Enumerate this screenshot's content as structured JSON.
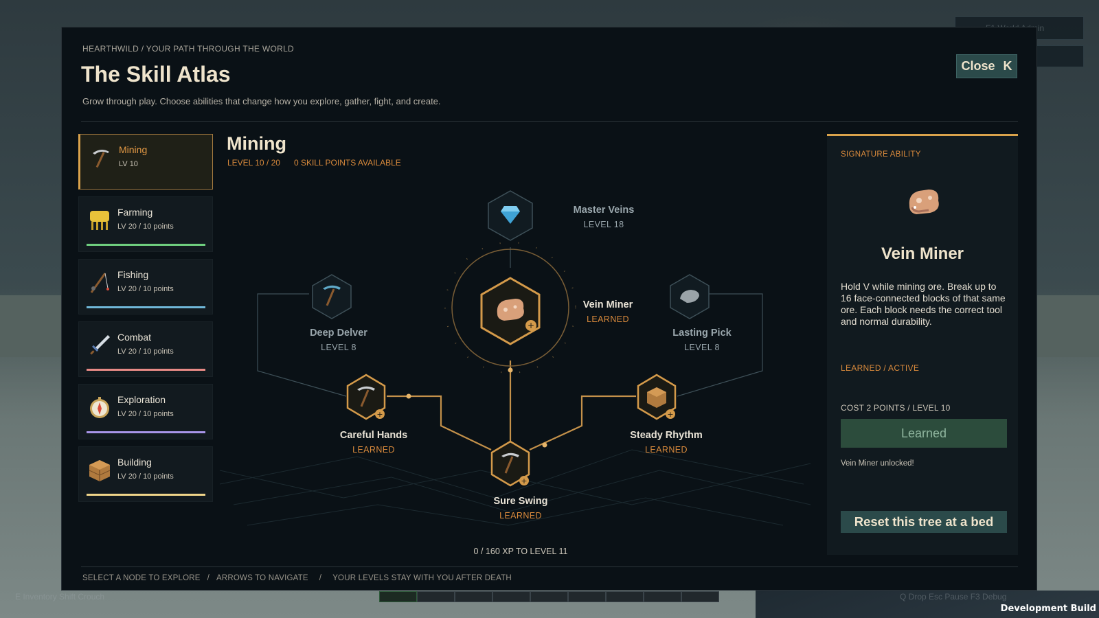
{
  "header": {
    "breadcrumb": "HEARTHWILD  /  YOUR PATH THROUGH THE WORLD",
    "title": "The Skill Atlas",
    "subtitle": "Grow through play. Choose abilities that change how you explore, gather, fight, and create.",
    "close_label": "Close",
    "close_key": "K"
  },
  "sidebar": {
    "items": [
      {
        "name": "Mining",
        "meta": "LV 10",
        "icon": "pickaxe-icon",
        "bar_color": "",
        "active": true
      },
      {
        "name": "Farming",
        "meta": "LV 20   /   10 points",
        "icon": "wheat-icon",
        "bar_color": "#6fcf7f"
      },
      {
        "name": "Fishing",
        "meta": "LV 20   /   10 points",
        "icon": "fishing-rod-icon",
        "bar_color": "#6fb7d8"
      },
      {
        "name": "Combat",
        "meta": "LV 20   /   10 points",
        "icon": "sword-icon",
        "bar_color": "#e88a86"
      },
      {
        "name": "Exploration",
        "meta": "LV 20   /   10 points",
        "icon": "compass-icon",
        "bar_color": "#a895e8"
      },
      {
        "name": "Building",
        "meta": "LV 20   /   10 points",
        "icon": "crate-icon",
        "bar_color": "#f0d58a"
      }
    ]
  },
  "tree": {
    "title": "Mining",
    "level": "LEVEL 10 / 20",
    "points": "0 SKILL POINTS AVAILABLE",
    "xp": "0 / 160 XP TO LEVEL 11",
    "nodes": {
      "master_veins": {
        "name": "Master Veins",
        "status": "LEVEL 18"
      },
      "vein_miner": {
        "name": "Vein Miner",
        "status": "LEARNED"
      },
      "deep_delver": {
        "name": "Deep Delver",
        "status": "LEVEL 8"
      },
      "lasting_pick": {
        "name": "Lasting Pick",
        "status": "LEVEL 8"
      },
      "careful_hands": {
        "name": "Careful Hands",
        "status": "LEARNED"
      },
      "steady_rhythm": {
        "name": "Steady Rhythm",
        "status": "LEARNED"
      },
      "sure_swing": {
        "name": "Sure Swing",
        "status": "LEARNED"
      }
    }
  },
  "detail": {
    "label": "SIGNATURE ABILITY",
    "icon": "ore-chunk-icon",
    "title": "Vein Miner",
    "description": "Hold V while mining ore. Break up to 16 face-connected blocks of that same ore. Each block needs the correct tool and normal durability.",
    "state": "LEARNED / ACTIVE",
    "cost": "COST  2 POINTS   /   LEVEL 10",
    "button": "Learned",
    "message": "Vein Miner unlocked!",
    "reset": "Reset this tree at a bed"
  },
  "footer": {
    "hint1": "SELECT A NODE TO EXPLORE",
    "sep1": "/",
    "hint2": "ARROWS TO NAVIGATE",
    "sep2": "/",
    "hint3": "YOUR LEVELS STAY WITH YOU AFTER DEATH"
  },
  "hud": {
    "top_right_text": "F1  World Admin",
    "bottom_left": "E  Inventory    Shift  Crouch",
    "bottom_right": "Q  Drop    Esc  Pause    F3  Debug",
    "dev_build": "Development Build"
  },
  "colors": {
    "accent": "#d9a24b",
    "learned": "#d98a3c",
    "panel": "#0a1116"
  }
}
